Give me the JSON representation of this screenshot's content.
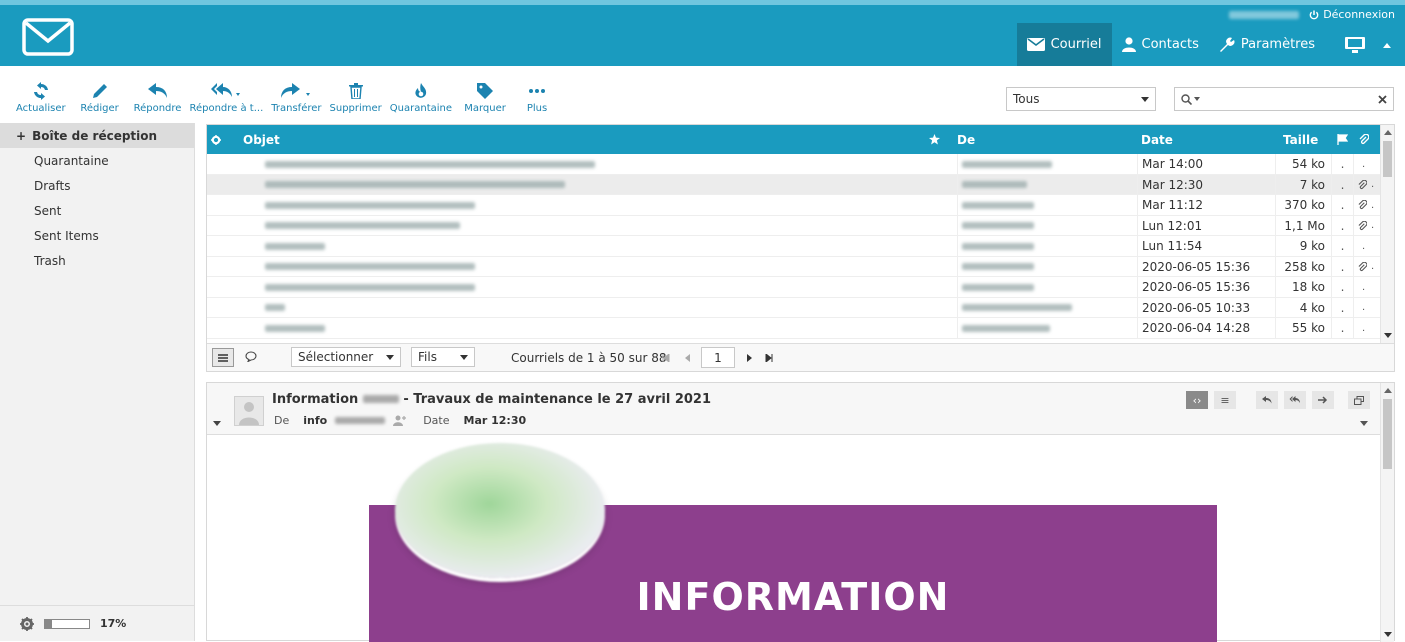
{
  "header": {
    "user_line": "",
    "logout_label": "Déconnexion",
    "nav": [
      {
        "label": "Courriel",
        "icon": "envelope-icon",
        "active": true
      },
      {
        "label": "Contacts",
        "icon": "user-icon",
        "active": false
      },
      {
        "label": "Paramètres",
        "icon": "wrench-icon",
        "active": false
      }
    ],
    "colors": {
      "bar": "#1a9bbf",
      "active": "#167c99"
    }
  },
  "toolbar": {
    "buttons": [
      {
        "label": "Actualiser",
        "icon": "refresh-icon"
      },
      {
        "label": "Rédiger",
        "icon": "pencil-icon"
      },
      {
        "label": "Répondre",
        "icon": "reply-icon"
      },
      {
        "label": "Répondre à t...",
        "icon": "reply-all-icon"
      },
      {
        "label": "Transférer",
        "icon": "forward-icon"
      },
      {
        "label": "Supprimer",
        "icon": "trash-icon"
      },
      {
        "label": "Quarantaine",
        "icon": "flame-icon"
      },
      {
        "label": "Marquer",
        "icon": "tag-icon"
      },
      {
        "label": "Plus",
        "icon": "more-icon"
      }
    ],
    "filter_value": "Tous",
    "search_value": ""
  },
  "sidebar": {
    "folders": [
      {
        "label": "Boîte de réception",
        "selected": true
      },
      {
        "label": "Quarantaine"
      },
      {
        "label": "Drafts"
      },
      {
        "label": "Sent"
      },
      {
        "label": "Sent Items"
      },
      {
        "label": "Trash"
      }
    ],
    "quota_percent": 17,
    "quota_label": "17%"
  },
  "list": {
    "columns": {
      "subject": "Objet",
      "from": "De",
      "date": "Date",
      "size": "Taille"
    },
    "rows": [
      {
        "date": "Mar 14:00",
        "size": "54 ko",
        "attachment": false,
        "subj_w": 330,
        "from_w": 90
      },
      {
        "date": "Mar 12:30",
        "size": "7 ko",
        "attachment": true,
        "selected": true,
        "subj_w": 300,
        "from_w": 65
      },
      {
        "date": "Mar 11:12",
        "size": "370 ko",
        "attachment": true,
        "subj_w": 210,
        "from_w": 72
      },
      {
        "date": "Lun 12:01",
        "size": "1,1 Mo",
        "attachment": true,
        "subj_w": 195,
        "from_w": 72
      },
      {
        "date": "Lun 11:54",
        "size": "9 ko",
        "attachment": false,
        "subj_w": 60,
        "from_w": 72
      },
      {
        "date": "2020-06-05 15:36",
        "size": "258 ko",
        "attachment": true,
        "subj_w": 210,
        "from_w": 72
      },
      {
        "date": "2020-06-05 15:36",
        "size": "18 ko",
        "attachment": false,
        "subj_w": 210,
        "from_w": 72
      },
      {
        "date": "2020-06-05 10:33",
        "size": "4 ko",
        "attachment": false,
        "subj_w": 20,
        "from_w": 110
      },
      {
        "date": "2020-06-04 14:28",
        "size": "55 ko",
        "attachment": false,
        "subj_w": 60,
        "from_w": 88
      }
    ],
    "footer": {
      "select_label": "Sélectionner",
      "threads_label": "Fils",
      "count_text": "Courriels de 1 à 50 sur 88",
      "page": "1"
    }
  },
  "preview": {
    "subject_prefix": "Information",
    "subject_suffix": "- Travaux de maintenance le 27 avril 2021",
    "from_label": "De",
    "from_value": "info",
    "date_label": "Date",
    "date_value": "Mar 12:30",
    "banner_title": "INFORMATION",
    "banner_color": "#8d3f8d"
  }
}
